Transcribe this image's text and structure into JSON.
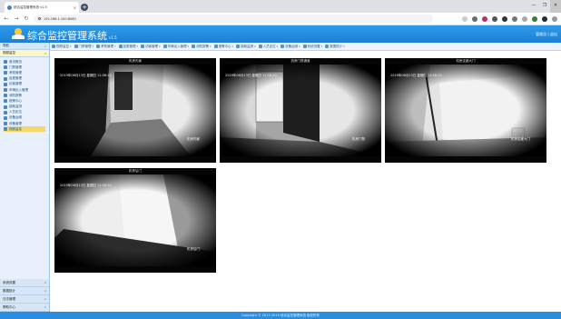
{
  "browser": {
    "tab_title": "综合监控管理系统 v1.5",
    "url": "192.168.1.100:8080",
    "window_controls": [
      "—",
      "❐",
      "✕"
    ]
  },
  "app": {
    "title": "综合监控管理系统",
    "version": "v1.5",
    "user": "管理员 | 退出"
  },
  "sidebar": {
    "header": "导航",
    "section": "视频监控",
    "items": [
      {
        "label": "首页概览",
        "icon": "home-icon"
      },
      {
        "label": "门禁管理",
        "icon": "door-icon"
      },
      {
        "label": "考勤管理",
        "icon": "clock-icon"
      },
      {
        "label": "巡更管理",
        "icon": "patrol-icon"
      },
      {
        "label": "访客管理",
        "icon": "visitor-icon"
      },
      {
        "label": "车辆出入管理",
        "icon": "car-icon"
      },
      {
        "label": "消防报警",
        "icon": "fire-icon"
      },
      {
        "label": "报警中心",
        "icon": "alarm-icon"
      },
      {
        "label": "能耗监测",
        "icon": "energy-icon"
      },
      {
        "label": "人员定位",
        "icon": "person-icon"
      },
      {
        "label": "设备运维",
        "icon": "device-icon"
      },
      {
        "label": "设备管理",
        "icon": "gear-icon"
      },
      {
        "label": "视频监控",
        "icon": "camera-icon",
        "active": true
      }
    ],
    "bottom": [
      "系统设置",
      "数据统计",
      "日志管理",
      "帮助中心"
    ]
  },
  "toolbar": [
    {
      "label": "视频监控"
    },
    {
      "label": "门禁管理"
    },
    {
      "label": "考勤管理"
    },
    {
      "label": "巡更管理"
    },
    {
      "label": "访客管理"
    },
    {
      "label": "车辆出入管理"
    },
    {
      "label": "消防报警"
    },
    {
      "label": "报警中心"
    },
    {
      "label": "能耗监测"
    },
    {
      "label": "人员定位"
    },
    {
      "label": "设备运维"
    },
    {
      "label": "系统设置"
    },
    {
      "label": "数据统计"
    }
  ],
  "cameras": [
    {
      "caption": "机房内景",
      "timestamp": "2019年06月13日  星期四  11:56:20",
      "name": "机房内景"
    },
    {
      "caption": "机房门禁通道",
      "timestamp": "2019年06月13日  星期四  11:56:20",
      "name": "机房门禁"
    },
    {
      "caption": "机房走廊大门",
      "timestamp": "2019年06月13日  星期四  11:56:20",
      "name": "机房走廊大门"
    },
    {
      "caption": "机房后门",
      "timestamp": "2019年06月13日  星期四  11:56:20",
      "name": "机房后门"
    }
  ],
  "footer": "Copyright © 2017-2019 综合监控管理系统 版权所有",
  "colors": {
    "header": "#1b80d6",
    "sidebar": "#e8f1fb",
    "footer": "#2a8de0",
    "active": "#f6d86a"
  }
}
